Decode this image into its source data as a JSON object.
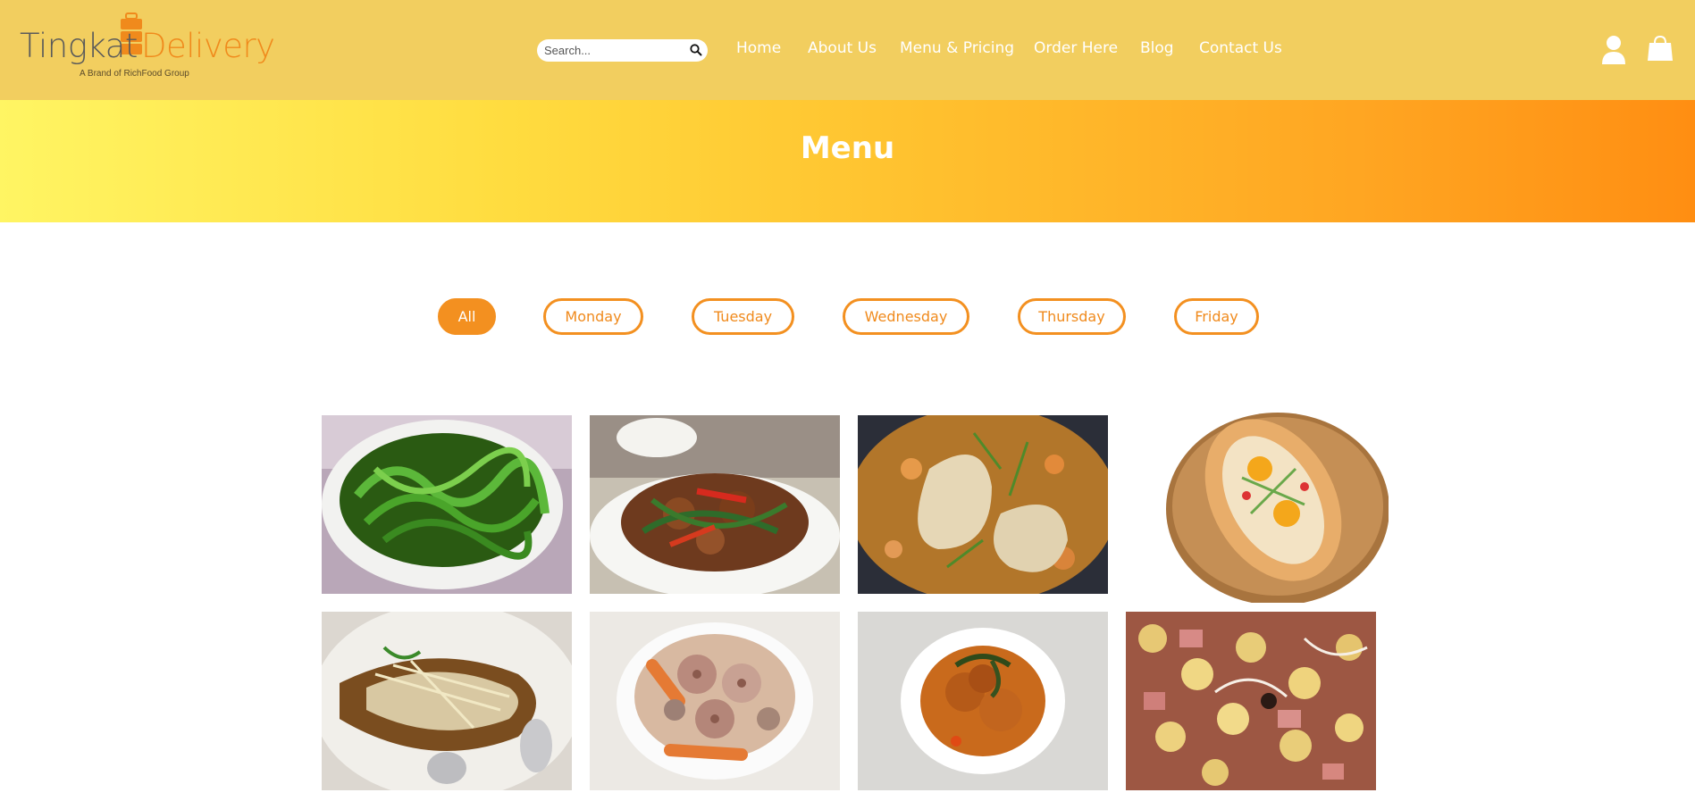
{
  "header": {
    "logo": {
      "word_left": "Tingkat",
      "word_right": "Delivery",
      "tagline": "A Brand of RichFood Group"
    },
    "search": {
      "placeholder": "Search..."
    },
    "nav": [
      {
        "label": "Home"
      },
      {
        "label": "About Us"
      },
      {
        "label": "Menu & Pricing"
      },
      {
        "label": "Order Here"
      },
      {
        "label": "Blog"
      },
      {
        "label": "Contact Us"
      }
    ]
  },
  "banner": {
    "title": "Menu"
  },
  "filters": [
    {
      "label": "All",
      "active": true
    },
    {
      "label": "Monday",
      "active": false
    },
    {
      "label": "Tuesday",
      "active": false
    },
    {
      "label": "Wednesday",
      "active": false
    },
    {
      "label": "Thursday",
      "active": false
    },
    {
      "label": "Friday",
      "active": false
    }
  ],
  "gallery": [
    {
      "dish": "stir-fried-greens"
    },
    {
      "dish": "pork-with-chili-and-beans"
    },
    {
      "dish": "chicken-stew"
    },
    {
      "dish": "egg-flatbread"
    },
    {
      "dish": "steamed-fish-with-ginger"
    },
    {
      "dish": "lotus-root-soup"
    },
    {
      "dish": "curry-chicken"
    },
    {
      "dish": "potato-sausage-fry"
    }
  ],
  "colors": {
    "header_bg": "#f2ce5f",
    "accent": "#f39020",
    "banner_start": "#fff563",
    "banner_end": "#ff8e12"
  }
}
